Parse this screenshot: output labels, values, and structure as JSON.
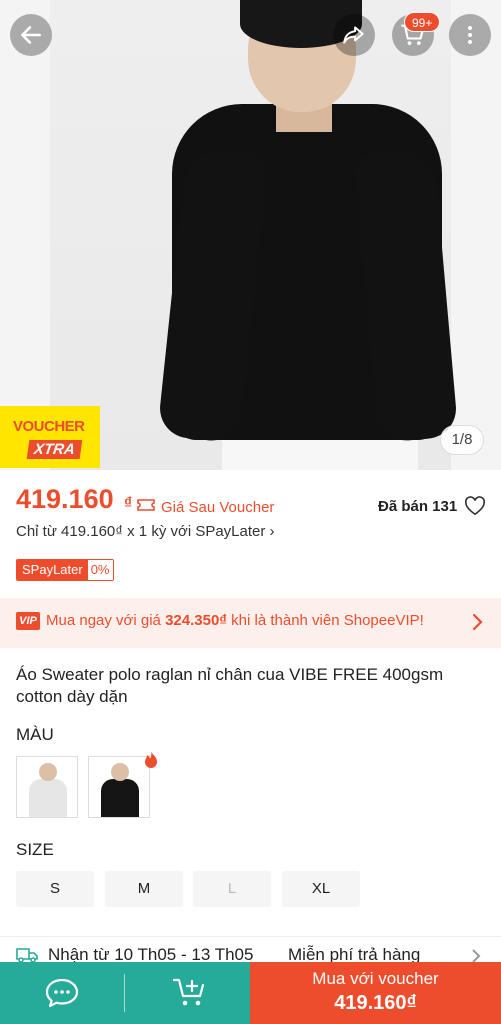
{
  "header": {
    "back_icon": "arrow-left-icon",
    "share_icon": "share-icon",
    "cart_icon": "cart-icon",
    "cart_badge": "99+",
    "more_icon": "more-vertical-icon"
  },
  "gallery": {
    "voucher_xtra_top": "VOUCHER",
    "voucher_xtra_bottom": "XTRA",
    "counter": "1/8"
  },
  "price": {
    "value": "419.160",
    "currency": "₫",
    "after_voucher_label": "Giá Sau Voucher",
    "sold": "Đã bán 131",
    "installment": "Chỉ từ 419.160₫ x 1 kỳ với SPayLater ›",
    "spaylater_badge": "SPayLater",
    "spaylater_rate": "0%"
  },
  "vip": {
    "logo": "VIP",
    "text_prefix": "Mua ngay với giá ",
    "vip_price": "324.350₫",
    "text_suffix": " khi là thành viên ShopeeVIP!"
  },
  "product": {
    "title": "Áo Sweater polo raglan nỉ chân cua VIBE FREE 400gsm cotton dày dặn"
  },
  "variants": {
    "color_label": "MÀU",
    "size_label": "SIZE",
    "sizes": [
      "S",
      "M",
      "L",
      "XL"
    ],
    "disabled_size": "L"
  },
  "shipping": {
    "delivery": "Nhận từ 10 Th05 - 13 Th05",
    "returns": "Miễn phí trả hàng"
  },
  "bottom_bar": {
    "chat_icon": "chat-icon",
    "add_to_cart_icon": "cart-plus-icon",
    "buy_line1": "Mua với voucher",
    "buy_line2": "419.160₫"
  },
  "colors": {
    "accent": "#ee4d2d",
    "green": "#26aa99",
    "voucher_yellow": "#ffe600"
  }
}
